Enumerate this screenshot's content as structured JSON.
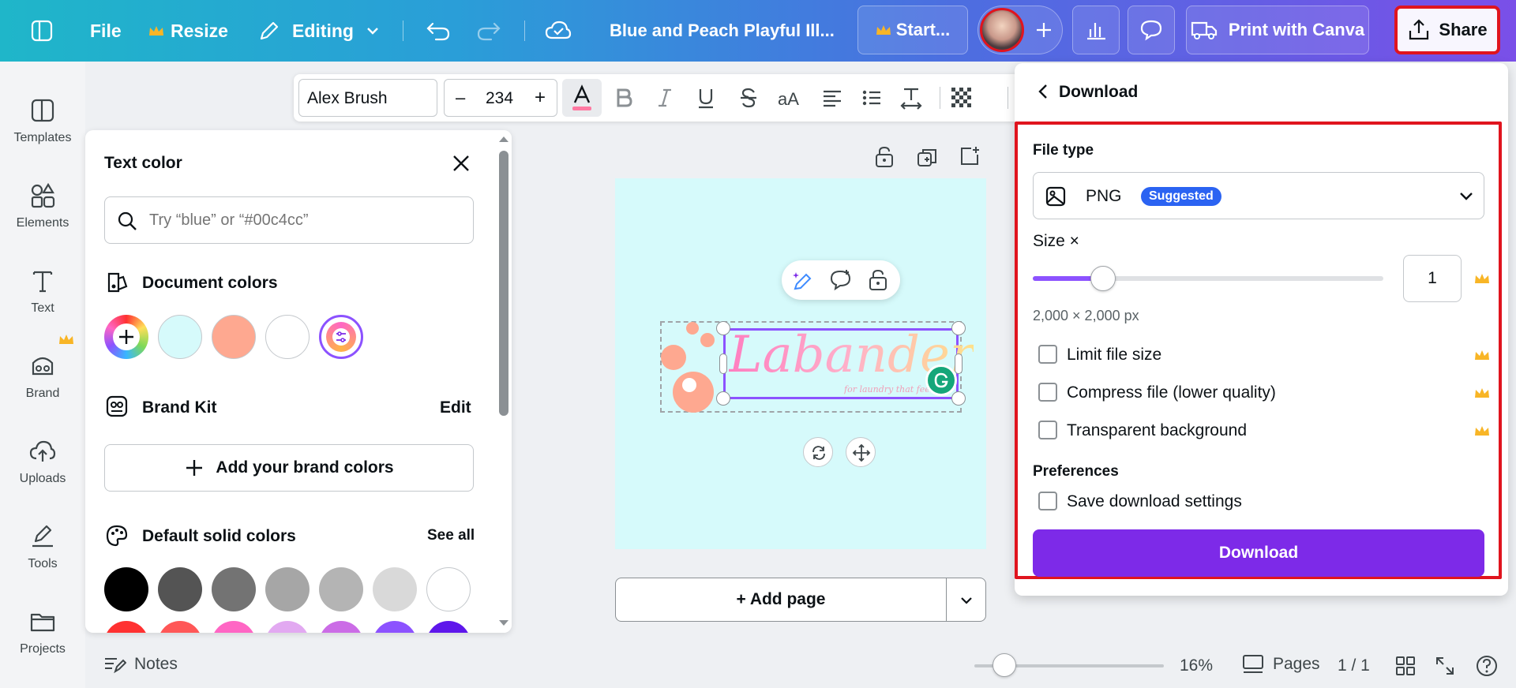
{
  "topbar": {
    "file_label": "File",
    "resize_label": "Resize",
    "editing_label": "Editing",
    "doc_title": "Blue and Peach Playful Ill...",
    "start_label": "Start...",
    "print_label": "Print with Canva",
    "share_label": "Share"
  },
  "rail": {
    "items": [
      {
        "label": "Templates",
        "icon": "templates-icon"
      },
      {
        "label": "Elements",
        "icon": "elements-icon"
      },
      {
        "label": "Text",
        "icon": "text-icon"
      },
      {
        "label": "Brand",
        "icon": "brand-icon"
      },
      {
        "label": "Uploads",
        "icon": "uploads-icon"
      },
      {
        "label": "Tools",
        "icon": "tools-icon"
      },
      {
        "label": "Projects",
        "icon": "projects-icon"
      }
    ]
  },
  "format_toolbar": {
    "font": "Alex Brush",
    "font_size": "234",
    "minus": "–",
    "plus": "+"
  },
  "color_panel": {
    "title": "Text color",
    "search_placeholder": "Try “blue” or “#00c4cc”",
    "document_colors_label": "Document colors",
    "document_colors": [
      "#d6fafb",
      "#fea890",
      "#ffffff"
    ],
    "brand_kit_label": "Brand Kit",
    "edit_label": "Edit",
    "add_brand_colors_label": "Add your brand colors",
    "default_colors_label": "Default solid colors",
    "see_all_label": "See all",
    "default_colors_row1": [
      "#000000",
      "#545454",
      "#737373",
      "#a6a6a6",
      "#b4b4b4",
      "#d9d9d9",
      "#ffffff"
    ],
    "default_colors_row2": [
      "#ff3131",
      "#ff5757",
      "#ff66c4",
      "#e2a9f1",
      "#cb6ce6",
      "#8c52ff",
      "#5e17eb"
    ]
  },
  "canvas": {
    "logo_text": "Labander",
    "tagline": "for laundry that feels",
    "add_page_label": "+ Add page"
  },
  "download_panel": {
    "back_title": "Download",
    "file_type_label": "File type",
    "file_type_value": "PNG",
    "suggested_badge": "Suggested",
    "size_label": "Size ×",
    "size_value": "1",
    "size_level": 0.2,
    "dimensions": "2,000 × 2,000 px",
    "options": [
      {
        "label": "Limit file size",
        "checked": false
      },
      {
        "label": "Compress file (lower quality)",
        "checked": false
      },
      {
        "label": "Transparent background",
        "checked": false
      }
    ],
    "preferences_label": "Preferences",
    "save_settings_label": "Save download settings",
    "download_button": "Download"
  },
  "bottombar": {
    "notes_label": "Notes",
    "zoom_value": "16%",
    "zoom_level": 0.16,
    "pages_label": "Pages",
    "page_count": "1 / 1"
  },
  "colors": {
    "accent": "#7d2ae8",
    "highlight": "#e0141e",
    "badge": "#2b63f2"
  }
}
